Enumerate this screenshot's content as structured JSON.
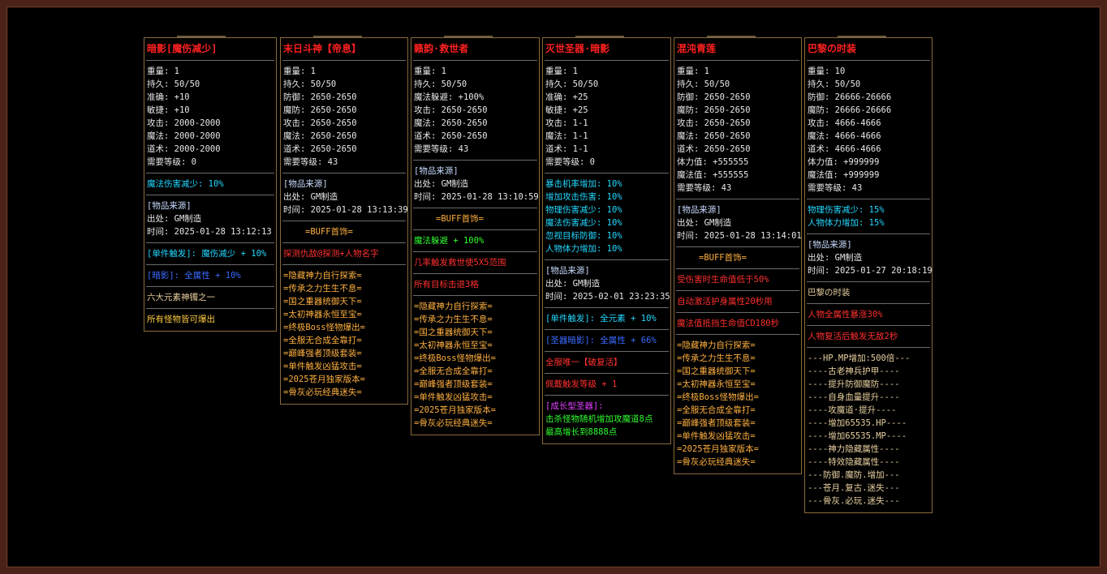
{
  "colors": {
    "title": "#ff2020",
    "stat": "#e8e8e8",
    "cyan": "#22d8ff",
    "blue": "#3a6aff",
    "red": "#ff3030",
    "orange": "#ffb040",
    "green": "#30ff30",
    "magenta": "#e040ff",
    "border": "#8a6a3a"
  },
  "panels": [
    {
      "title": "暗影[魔伤减少]",
      "sections": [
        {
          "lines": [
            {
              "t": "重量: 1",
              "c": "white"
            },
            {
              "t": "持久: 50/50",
              "c": "white"
            },
            {
              "t": "准确: +10",
              "c": "white"
            },
            {
              "t": "敏捷: +10",
              "c": "white"
            },
            {
              "t": "攻击: 2000-2000",
              "c": "white"
            },
            {
              "t": "魔法: 2000-2000",
              "c": "white"
            },
            {
              "t": "道术: 2000-2000",
              "c": "white"
            },
            {
              "t": "需要等级: 0",
              "c": "white"
            }
          ]
        },
        {
          "lines": [
            {
              "t": "魔法伤害减少: 10%",
              "c": "cyan"
            }
          ]
        },
        {
          "lines": [
            {
              "t": "[物品来源]",
              "c": "pale"
            },
            {
              "t": "出处: GM制造",
              "c": "white"
            },
            {
              "t": "时间: 2025-01-28 13:12:13",
              "c": "white"
            }
          ]
        },
        {
          "lines": [
            {
              "t": "[单件触发]: 魔伤减少 + 10%",
              "c": "cyan"
            }
          ]
        },
        {
          "lines": [
            {
              "t": "[暗影]: 全属性 + 10%",
              "c": "blue"
            }
          ]
        },
        {
          "lines": [
            {
              "t": "六大元素神镯之一",
              "c": "tan"
            }
          ]
        },
        {
          "lines": [
            {
              "t": "所有怪物皆可爆出",
              "c": "gold"
            }
          ]
        }
      ]
    },
    {
      "title": "末日斗神【帝息】",
      "sections": [
        {
          "lines": [
            {
              "t": "重量: 1",
              "c": "white"
            },
            {
              "t": "持久: 50/50",
              "c": "white"
            },
            {
              "t": "防御: 2650-2650",
              "c": "white"
            },
            {
              "t": "魔防: 2650-2650",
              "c": "white"
            },
            {
              "t": "攻击: 2650-2650",
              "c": "white"
            },
            {
              "t": "魔法: 2650-2650",
              "c": "white"
            },
            {
              "t": "道术: 2650-2650",
              "c": "white"
            },
            {
              "t": "需要等级: 43",
              "c": "white"
            }
          ]
        },
        {
          "lines": [
            {
              "t": "[物品来源]",
              "c": "pale"
            },
            {
              "t": "出处: GM制造",
              "c": "white"
            },
            {
              "t": "时间: 2025-01-28 13:13:39",
              "c": "white"
            }
          ]
        },
        {
          "lines": [
            {
              "t": "=BUFF首饰=",
              "c": "orange",
              "center": true
            }
          ]
        },
        {
          "lines": [
            {
              "t": "探测仇敌@探测+人物名字",
              "c": "red"
            }
          ]
        },
        {
          "lines": [
            {
              "t": "=隐藏神力自行探索=",
              "c": "orange"
            },
            {
              "t": "=传承之力生生不息=",
              "c": "orange"
            },
            {
              "t": "=国之重器统御天下=",
              "c": "orange"
            },
            {
              "t": "=太初神器永恒至宝=",
              "c": "orange"
            },
            {
              "t": "=终极Boss怪物爆出=",
              "c": "orange"
            },
            {
              "t": "=全服无合成全靠打=",
              "c": "orange"
            },
            {
              "t": "=巅峰强者顶级套装=",
              "c": "orange"
            },
            {
              "t": "=单件触发凶猛攻击=",
              "c": "orange"
            },
            {
              "t": "=2025苍月独家版本=",
              "c": "orange"
            },
            {
              "t": "=骨灰必玩经典迷失=",
              "c": "orange"
            }
          ]
        }
      ]
    },
    {
      "title": "籁韵·救世者",
      "sections": [
        {
          "lines": [
            {
              "t": "重量: 1",
              "c": "white"
            },
            {
              "t": "持久: 50/50",
              "c": "white"
            },
            {
              "t": "魔法躲避: +100%",
              "c": "white"
            },
            {
              "t": "攻击: 2650-2650",
              "c": "white"
            },
            {
              "t": "魔法: 2650-2650",
              "c": "white"
            },
            {
              "t": "道术: 2650-2650",
              "c": "white"
            },
            {
              "t": "需要等级: 43",
              "c": "white"
            }
          ]
        },
        {
          "lines": [
            {
              "t": "[物品来源]",
              "c": "pale"
            },
            {
              "t": "出处: GM制造",
              "c": "white"
            },
            {
              "t": "时间: 2025-01-28 13:10:59",
              "c": "white"
            }
          ]
        },
        {
          "lines": [
            {
              "t": "=BUFF首饰=",
              "c": "orange",
              "center": true
            }
          ]
        },
        {
          "lines": [
            {
              "t": "魔法躲避 + 100%",
              "c": "green"
            }
          ]
        },
        {
          "lines": [
            {
              "t": "几率触发救世使5X5范围",
              "c": "red"
            }
          ]
        },
        {
          "lines": [
            {
              "t": "所有目标击退3格",
              "c": "red"
            }
          ]
        },
        {
          "lines": [
            {
              "t": "=隐藏神力自行探索=",
              "c": "orange"
            },
            {
              "t": "=传承之力生生不息=",
              "c": "orange"
            },
            {
              "t": "=国之重器统御天下=",
              "c": "orange"
            },
            {
              "t": "=太初神器永恒至宝=",
              "c": "orange"
            },
            {
              "t": "=终极Boss怪物爆出=",
              "c": "orange"
            },
            {
              "t": "=全服无合成全靠打=",
              "c": "orange"
            },
            {
              "t": "=巅峰强者顶级套装=",
              "c": "orange"
            },
            {
              "t": "=单件触发凶猛攻击=",
              "c": "orange"
            },
            {
              "t": "=2025苍月独家版本=",
              "c": "orange"
            },
            {
              "t": "=骨灰必玩经典迷失=",
              "c": "orange"
            }
          ]
        }
      ]
    },
    {
      "title": "灭世圣器·暗影",
      "sections": [
        {
          "lines": [
            {
              "t": "重量: 1",
              "c": "white"
            },
            {
              "t": "持久: 50/50",
              "c": "white"
            },
            {
              "t": "准确: +25",
              "c": "white"
            },
            {
              "t": "敏捷: +25",
              "c": "white"
            },
            {
              "t": "攻击: 1-1",
              "c": "white"
            },
            {
              "t": "魔法: 1-1",
              "c": "white"
            },
            {
              "t": "道术: 1-1",
              "c": "white"
            },
            {
              "t": "需要等级: 0",
              "c": "white"
            }
          ]
        },
        {
          "lines": [
            {
              "t": "暴击机率增加: 10%",
              "c": "cyan"
            },
            {
              "t": "增加攻击伤害: 10%",
              "c": "cyan"
            },
            {
              "t": "物理伤害减少: 10%",
              "c": "cyan"
            },
            {
              "t": "魔法伤害减少: 10%",
              "c": "cyan"
            },
            {
              "t": "忽视目标防御: 10%",
              "c": "cyan"
            },
            {
              "t": "人物体力增加: 10%",
              "c": "cyan"
            }
          ]
        },
        {
          "lines": [
            {
              "t": "[物品来源]",
              "c": "pale"
            },
            {
              "t": "出处: GM制造",
              "c": "white"
            },
            {
              "t": "时间: 2025-02-01 23:23:35",
              "c": "white"
            }
          ]
        },
        {
          "lines": [
            {
              "t": "[单件触发]: 全元素 + 10%",
              "c": "cyan"
            }
          ]
        },
        {
          "lines": [
            {
              "t": "[圣器暗影]: 全属性 + 66%",
              "c": "blue"
            }
          ]
        },
        {
          "lines": [
            {
              "t": "全服唯一【破复活】",
              "c": "red"
            }
          ]
        },
        {
          "lines": [
            {
              "t": "佩戴触发等级 + 1",
              "c": "red"
            }
          ]
        },
        {
          "lines": [
            {
              "t": "[成长型圣器]:",
              "c": "magenta"
            },
            {
              "t": "击杀怪物随机增加攻魔道8点",
              "c": "green"
            },
            {
              "t": "最高增长到8888点",
              "c": "green"
            }
          ]
        }
      ]
    },
    {
      "title": "混沌青莲",
      "sections": [
        {
          "lines": [
            {
              "t": "重量: 1",
              "c": "white"
            },
            {
              "t": "持久: 50/50",
              "c": "white"
            },
            {
              "t": "防御: 2650-2650",
              "c": "white"
            },
            {
              "t": "魔防: 2650-2650",
              "c": "white"
            },
            {
              "t": "攻击: 2650-2650",
              "c": "white"
            },
            {
              "t": "魔法: 2650-2650",
              "c": "white"
            },
            {
              "t": "道术: 2650-2650",
              "c": "white"
            },
            {
              "t": "体力值: +555555",
              "c": "white"
            },
            {
              "t": "魔法值: +555555",
              "c": "white"
            },
            {
              "t": "需要等级: 43",
              "c": "white"
            }
          ]
        },
        {
          "lines": [
            {
              "t": "[物品来源]",
              "c": "pale"
            },
            {
              "t": "出处: GM制造",
              "c": "white"
            },
            {
              "t": "时间: 2025-01-28 13:14:01",
              "c": "white"
            }
          ]
        },
        {
          "lines": [
            {
              "t": "=BUFF首饰=",
              "c": "orange",
              "center": true
            }
          ]
        },
        {
          "lines": [
            {
              "t": "受伤害时生命值低于50%",
              "c": "red"
            }
          ]
        },
        {
          "lines": [
            {
              "t": "自动激活护身属性20秒用",
              "c": "red"
            }
          ]
        },
        {
          "lines": [
            {
              "t": "魔法值抵挡生命值CD180秒",
              "c": "red"
            }
          ]
        },
        {
          "lines": [
            {
              "t": "=隐藏神力自行探索=",
              "c": "orange"
            },
            {
              "t": "=传承之力生生不息=",
              "c": "orange"
            },
            {
              "t": "=国之重器统御天下=",
              "c": "orange"
            },
            {
              "t": "=太初神器永恒至宝=",
              "c": "orange"
            },
            {
              "t": "=终极Boss怪物爆出=",
              "c": "orange"
            },
            {
              "t": "=全服无合成全靠打=",
              "c": "orange"
            },
            {
              "t": "=巅峰强者顶级套装=",
              "c": "orange"
            },
            {
              "t": "=单件触发凶猛攻击=",
              "c": "orange"
            },
            {
              "t": "=2025苍月独家版本=",
              "c": "orange"
            },
            {
              "t": "=骨灰必玩经典迷失=",
              "c": "orange"
            }
          ]
        }
      ]
    },
    {
      "title": "巴黎の时装",
      "sections": [
        {
          "lines": [
            {
              "t": "重量: 10",
              "c": "white"
            },
            {
              "t": "持久: 50/50",
              "c": "white"
            },
            {
              "t": "防御: 26666-26666",
              "c": "white"
            },
            {
              "t": "魔防: 26666-26666",
              "c": "white"
            },
            {
              "t": "攻击: 4666-4666",
              "c": "white"
            },
            {
              "t": "魔法: 4666-4666",
              "c": "white"
            },
            {
              "t": "道术: 4666-4666",
              "c": "white"
            },
            {
              "t": "体力值: +999999",
              "c": "white"
            },
            {
              "t": "魔法值: +999999",
              "c": "white"
            },
            {
              "t": "需要等级: 43",
              "c": "white"
            }
          ]
        },
        {
          "lines": [
            {
              "t": "物理伤害减少: 15%",
              "c": "cyan"
            },
            {
              "t": "人物体力增加: 15%",
              "c": "cyan"
            }
          ]
        },
        {
          "lines": [
            {
              "t": "[物品来源]",
              "c": "pale"
            },
            {
              "t": "出处: GM制造",
              "c": "white"
            },
            {
              "t": "时间: 2025-01-27 20:18:19",
              "c": "white"
            }
          ]
        },
        {
          "lines": [
            {
              "t": "巴黎の时装",
              "c": "tan"
            }
          ]
        },
        {
          "lines": [
            {
              "t": "人物全属性暴涨30%",
              "c": "red"
            }
          ]
        },
        {
          "lines": [
            {
              "t": "人物复活后触发无敌2秒",
              "c": "red"
            }
          ]
        },
        {
          "lines": [
            {
              "t": "---HP.MP增加:500倍---",
              "c": "tan"
            },
            {
              "t": "----古老神兵护甲----",
              "c": "tan"
            },
            {
              "t": "----提升防御魔防----",
              "c": "tan"
            },
            {
              "t": "----自身血量提升----",
              "c": "tan"
            },
            {
              "t": "----攻魔道·提升----",
              "c": "tan"
            },
            {
              "t": "----增加65535.HP----",
              "c": "tan"
            },
            {
              "t": "----增加65535.MP----",
              "c": "tan"
            },
            {
              "t": "----神力隐藏属性----",
              "c": "tan"
            },
            {
              "t": "----特效隐藏属性----",
              "c": "tan"
            },
            {
              "t": "---防御.魔防.增加---",
              "c": "tan"
            },
            {
              "t": "---苍月.复古.迷失---",
              "c": "tan"
            },
            {
              "t": "---骨灰.必玩.迷失---",
              "c": "tan"
            }
          ]
        }
      ]
    }
  ]
}
